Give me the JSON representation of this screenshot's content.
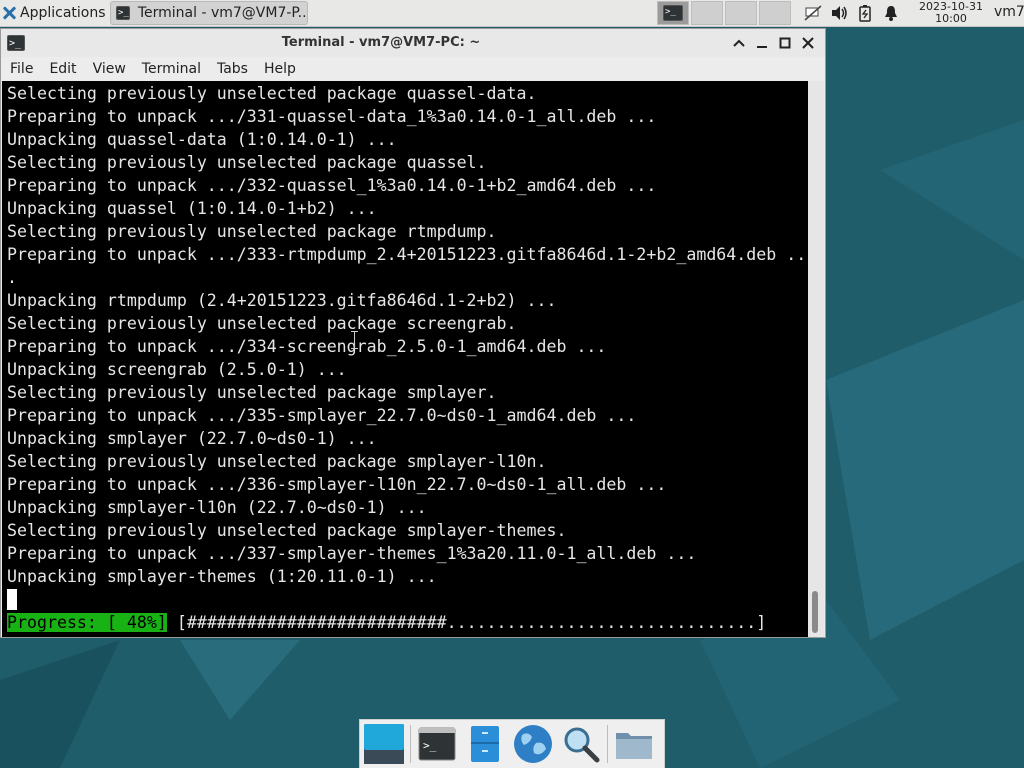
{
  "top_panel": {
    "applications_label": "Applications",
    "task_label": "Terminal - vm7@VM7-P...",
    "clock_date": "2023-10-31",
    "clock_time": "10:00",
    "user": "vm7",
    "tray_icons": [
      "network-icon",
      "volume-icon",
      "battery-icon",
      "notification-bell-icon"
    ]
  },
  "window": {
    "title": "Terminal - vm7@VM7-PC: ~",
    "menu": [
      "File",
      "Edit",
      "View",
      "Terminal",
      "Tabs",
      "Help"
    ],
    "controls": [
      "restore-up",
      "minimize",
      "maximize",
      "close"
    ]
  },
  "terminal": {
    "lines": [
      "Selecting previously unselected package quassel-data.",
      "Preparing to unpack .../331-quassel-data_1%3a0.14.0-1_all.deb ...",
      "Unpacking quassel-data (1:0.14.0-1) ...",
      "Selecting previously unselected package quassel.",
      "Preparing to unpack .../332-quassel_1%3a0.14.0-1+b2_amd64.deb ...",
      "Unpacking quassel (1:0.14.0-1+b2) ...",
      "Selecting previously unselected package rtmpdump.",
      "Preparing to unpack .../333-rtmpdump_2.4+20151223.gitfa8646d.1-2+b2_amd64.deb ..",
      ".",
      "Unpacking rtmpdump (2.4+20151223.gitfa8646d.1-2+b2) ...",
      "Selecting previously unselected package screengrab.",
      "Preparing to unpack .../334-screengrab_2.5.0-1_amd64.deb ...",
      "Unpacking screengrab (2.5.0-1) ...",
      "Selecting previously unselected package smplayer.",
      "Preparing to unpack .../335-smplayer_22.7.0~ds0-1_amd64.deb ...",
      "Unpacking smplayer (22.7.0~ds0-1) ...",
      "Selecting previously unselected package smplayer-l10n.",
      "Preparing to unpack .../336-smplayer-l10n_22.7.0~ds0-1_all.deb ...",
      "Unpacking smplayer-l10n (22.7.0~ds0-1) ...",
      "Selecting previously unselected package smplayer-themes.",
      "Preparing to unpack .../337-smplayer-themes_1%3a20.11.0-1_all.deb ...",
      "Unpacking smplayer-themes (1:20.11.0-1) ..."
    ],
    "progress_label": "Progress: [ 48%]",
    "progress_bar": " [##########################...............................]",
    "progress_fraction": 0.48
  },
  "dock": {
    "items": [
      "show-desktop-icon",
      "terminal-icon",
      "file-manager-icon",
      "web-browser-icon",
      "search-icon",
      "folder-icon"
    ]
  }
}
